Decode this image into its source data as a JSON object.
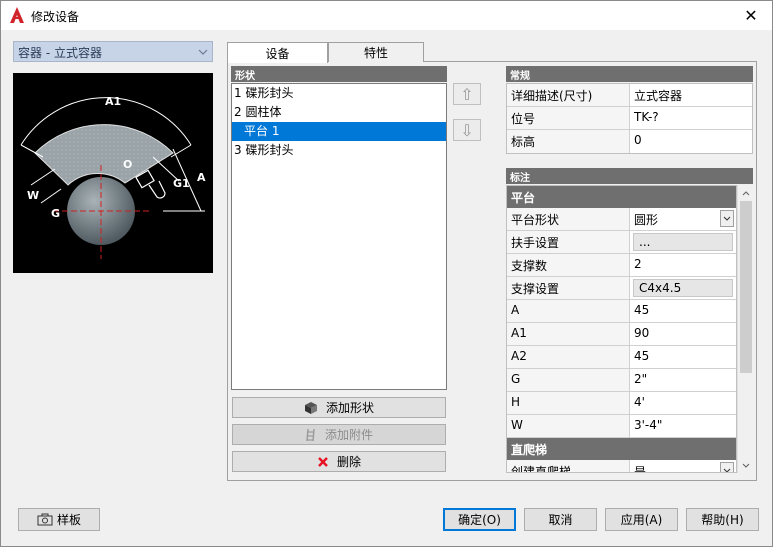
{
  "window": {
    "title": "修改设备",
    "close_glyph": "✕"
  },
  "equipment_combo": {
    "value": "容器 - 立式容器"
  },
  "preview_labels": {
    "a1": "A1",
    "o": "O",
    "w": "W",
    "g": "G",
    "g1": "G1",
    "a": "A"
  },
  "tabs": [
    {
      "label": "设备"
    },
    {
      "label": "特性"
    }
  ],
  "shapes": {
    "header": "形状",
    "items": [
      {
        "label": "1 碟形封头"
      },
      {
        "label": "2 圆柱体"
      },
      {
        "label": "平台 1",
        "selected": true
      },
      {
        "label": "3 碟形封头"
      }
    ]
  },
  "move_buttons": {
    "up_glyph": "⇧",
    "down_glyph": "⇩"
  },
  "actions": {
    "add_shape": "添加形状",
    "add_attachment": "添加附件",
    "delete": "删除"
  },
  "general": {
    "header": "常规",
    "rows": [
      {
        "label": "详细描述(尺寸)",
        "value": "立式容器"
      },
      {
        "label": "位号",
        "value": "TK-?"
      },
      {
        "label": "标高",
        "value": "0"
      }
    ]
  },
  "annotation": {
    "header": "标注",
    "platform_section": "平台",
    "platform_rows": [
      {
        "label": "平台形状",
        "value": "圆形"
      },
      {
        "label": "扶手设置",
        "value": "..."
      },
      {
        "label": "支撑数",
        "value": "2"
      },
      {
        "label": "支撑设置",
        "value": "C4x4.5"
      },
      {
        "label": "A",
        "value": "45"
      },
      {
        "label": "A1",
        "value": "90"
      },
      {
        "label": "A2",
        "value": "45"
      },
      {
        "label": "G",
        "value": "2\""
      },
      {
        "label": "H",
        "value": "4'"
      },
      {
        "label": "W",
        "value": "3'-4\""
      }
    ],
    "ladder_section": "直爬梯",
    "partial_row": {
      "label": "创建直爬梯",
      "value": "是"
    }
  },
  "bottom": {
    "template": "样板",
    "ok": "确定(O)",
    "cancel": "取消",
    "apply": "应用(A)",
    "help": "帮助(H)"
  },
  "colors": {
    "accent": "#0078d7",
    "header": "#6f6f6f",
    "delete_x": "#e81123",
    "autocad_red": "#d1232a"
  }
}
